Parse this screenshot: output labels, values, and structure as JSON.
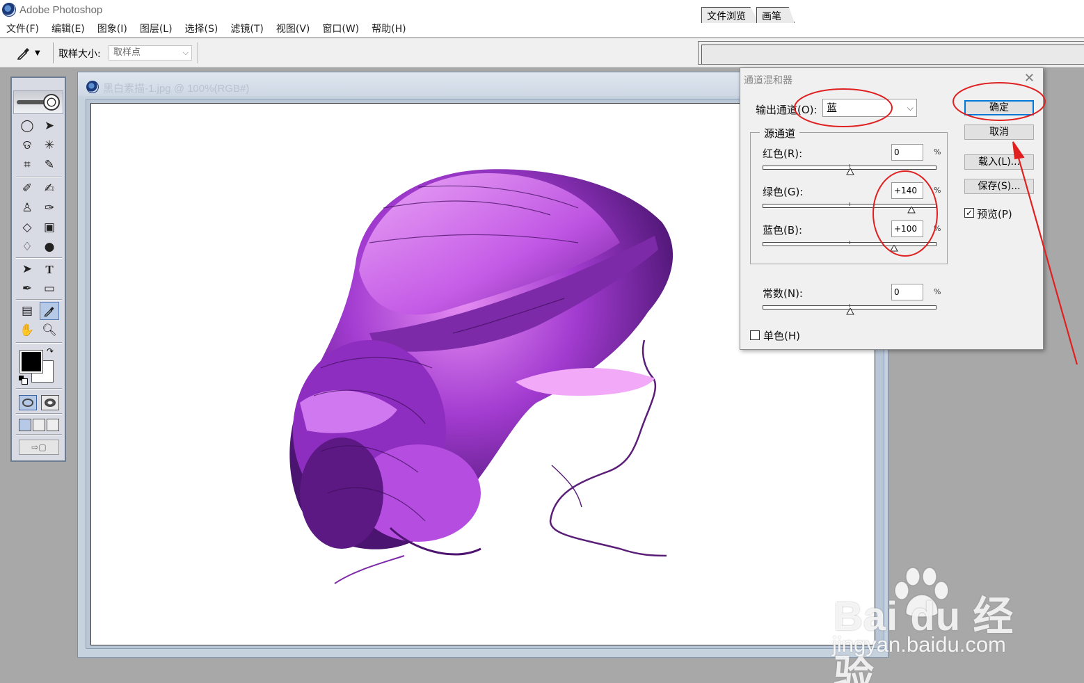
{
  "window": {
    "title": "Adobe Photoshop"
  },
  "menu": [
    "文件(F)",
    "编辑(E)",
    "图象(I)",
    "图层(L)",
    "选择(S)",
    "滤镜(T)",
    "视图(V)",
    "窗口(W)",
    "帮助(H)"
  ],
  "options_bar": {
    "sample_size_label": "取样大小:",
    "sample_size_value": "取样点"
  },
  "palette_well": {
    "tabs": [
      "文件浏览",
      "画笔"
    ]
  },
  "document": {
    "title": "黑白素描-1.jpg @ 100%(RGB#)"
  },
  "dialog": {
    "title": "通道混和器",
    "output_channel_label": "输出通道(O):",
    "output_channel_value": "蓝",
    "source_group_label": "源通道",
    "channels": [
      {
        "label": "红色(R):",
        "value": "0",
        "unit": "%",
        "slider_fraction": 0.5
      },
      {
        "label": "绿色(G):",
        "value": "+140",
        "unit": "%",
        "slider_fraction": 0.85
      },
      {
        "label": "蓝色(B):",
        "value": "+100",
        "unit": "%",
        "slider_fraction": 0.75
      }
    ],
    "constant": {
      "label": "常数(N):",
      "value": "0",
      "unit": "%",
      "slider_fraction": 0.5
    },
    "monochrome": {
      "label": "单色(H)",
      "checked": false
    },
    "buttons": {
      "ok": "确定",
      "cancel": "取消",
      "load": "载入(L)...",
      "save": "保存(S)..."
    },
    "preview": {
      "label": "预览(P)",
      "checked": true
    },
    "close_icon": "close-icon"
  },
  "watermark": {
    "brand": "Bai du 经验",
    "url": "jingyan.baidu.com"
  },
  "annotation_color": "#e02020",
  "hair_color": "#9a32c8"
}
